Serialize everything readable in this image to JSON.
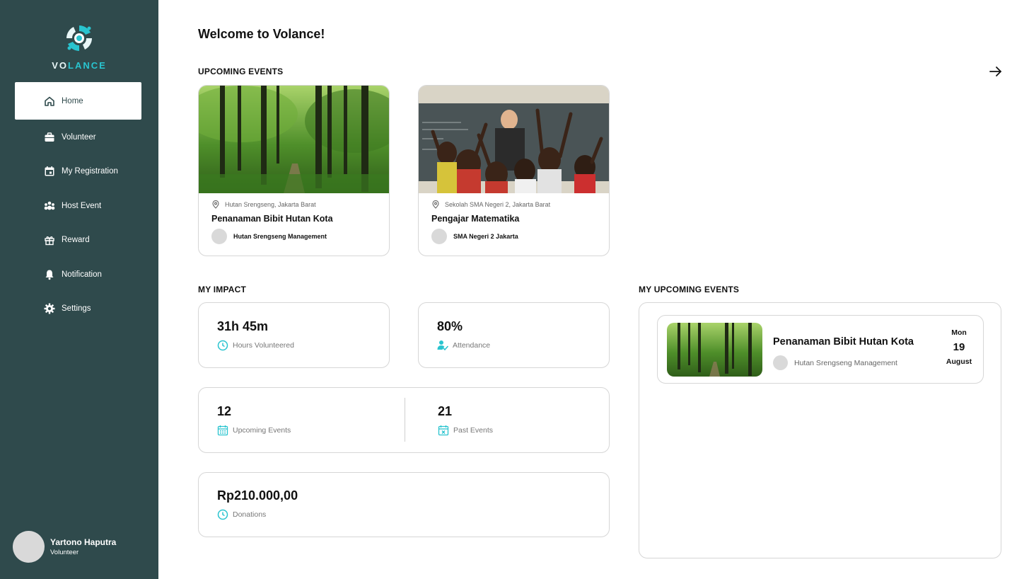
{
  "app": {
    "logo_text_highlight": "V",
    "logo_text_o": "O",
    "logo_text_rest": "LANCE"
  },
  "sidebar": {
    "items": [
      {
        "label": "Home",
        "icon": "home-icon",
        "active": true
      },
      {
        "label": "Volunteer",
        "icon": "briefcase-icon"
      },
      {
        "label": "My Registration",
        "icon": "calendar-icon"
      },
      {
        "label": "Host Event",
        "icon": "group-icon"
      },
      {
        "label": "Reward",
        "icon": "gift-icon"
      },
      {
        "label": "Notification",
        "icon": "bell-icon"
      },
      {
        "label": "Settings",
        "icon": "gear-icon"
      }
    ]
  },
  "user": {
    "name": "Yartono Haputra",
    "role": "Volunteer"
  },
  "main": {
    "welcome": "Welcome to Volance!",
    "upcoming_title": "UPCOMING EVENTS",
    "events": [
      {
        "location": "Hutan Srengseng, Jakarta Barat",
        "title": "Penanaman Bibit Hutan Kota",
        "organizer": "Hutan Srengseng Management"
      },
      {
        "location": "Sekolah SMA Negeri 2, Jakarta Barat",
        "title": "Pengajar Matematika",
        "organizer": "SMA Negeri 2 Jakarta"
      }
    ],
    "impact_title": "MY IMPACT",
    "impact": {
      "hours": {
        "value": "31h 45m",
        "label": "Hours Volunteered"
      },
      "attendance": {
        "value": "80%",
        "label": "Attendance"
      },
      "upcoming": {
        "value": "12",
        "label": "Upcoming Events"
      },
      "past": {
        "value": "21",
        "label": "Past Events"
      },
      "donations": {
        "value": "Rp210.000,00",
        "label": "Donations"
      }
    },
    "my_upcoming_title": "MY UPCOMING EVENTS",
    "my_upcoming": [
      {
        "title": "Penanaman Bibit Hutan Kota",
        "organizer": "Hutan Srengseng Management",
        "day": "Mon",
        "date": "19",
        "month": "August"
      }
    ]
  },
  "colors": {
    "sidebar": "#2f4a4c",
    "accent": "#29c4cf",
    "border": "#d6d6d6"
  }
}
